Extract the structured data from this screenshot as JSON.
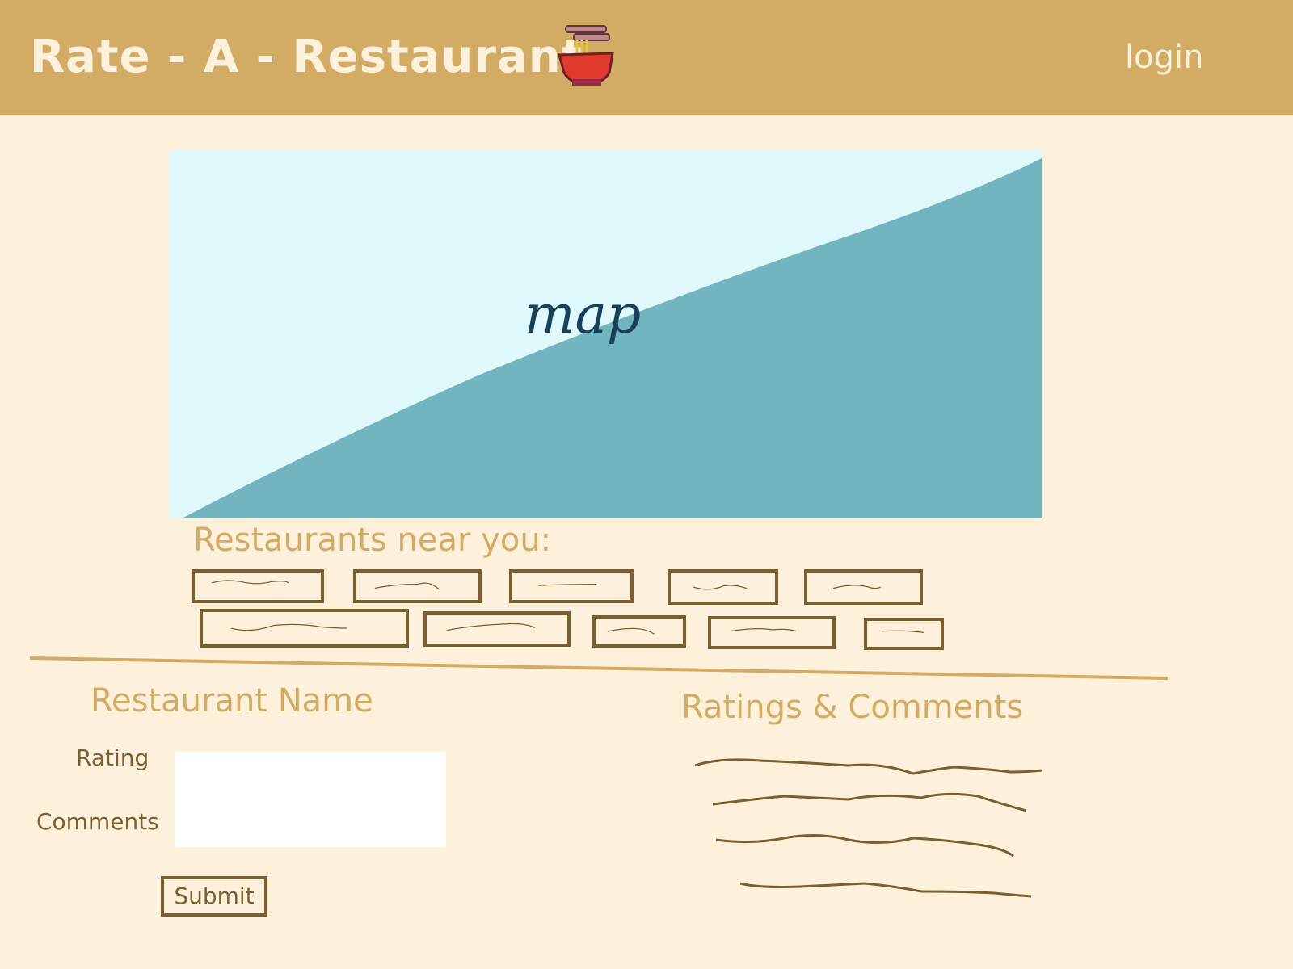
{
  "header": {
    "title": "Rate - A - Restaurant",
    "logo_icon": "noodle-bowl-icon",
    "login_label": "login"
  },
  "map": {
    "label": "map",
    "colors": {
      "sky": "#dff8fb",
      "land": "#72b5bf",
      "label": "#17405a"
    }
  },
  "nearby": {
    "title": "Restaurants near you:",
    "items_count_note": "",
    "items": [
      {
        "label": ""
      },
      {
        "label": ""
      },
      {
        "label": ""
      },
      {
        "label": ""
      },
      {
        "label": ""
      },
      {
        "label": ""
      },
      {
        "label": ""
      },
      {
        "label": ""
      },
      {
        "label": ""
      },
      {
        "label": ""
      }
    ]
  },
  "detail": {
    "title": "Restaurant Name",
    "rating_label": "Rating",
    "comments_label": "Comments",
    "input_value": "",
    "submit_label": "Submit"
  },
  "ratings": {
    "title": "Ratings & Comments"
  },
  "colors": {
    "background": "#fdf1dc",
    "header": "#d2ab64",
    "accent_text": "#d2ab64",
    "dark_brown": "#7d5e2e",
    "bowl_red": "#e03a2f"
  }
}
